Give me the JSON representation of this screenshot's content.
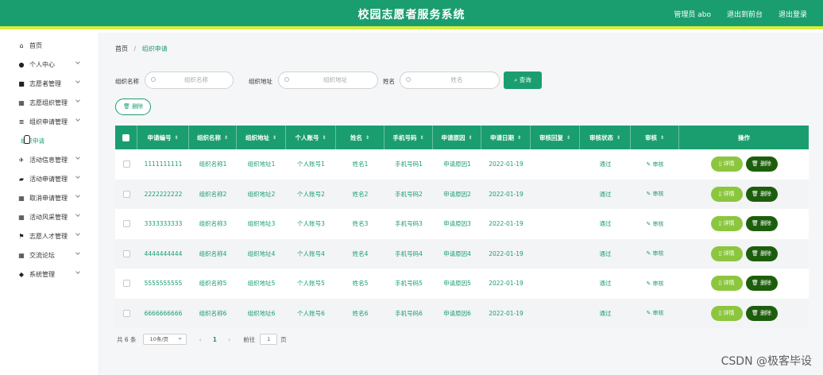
{
  "header": {
    "title": "校园志愿者服务系统",
    "user": "管理员 abo",
    "back_link": "退出到前台",
    "logout": "退出登录"
  },
  "sidebar": {
    "items": [
      {
        "label": "首页",
        "icon": "home-icon",
        "expandable": false
      },
      {
        "label": "个人中心",
        "icon": "user-icon",
        "expandable": true
      },
      {
        "label": "志愿者管理",
        "icon": "lock-icon",
        "expandable": true
      },
      {
        "label": "志愿组织管理",
        "icon": "grid-icon",
        "expandable": true
      },
      {
        "label": "组织申请管理",
        "icon": "list-icon",
        "expandable": true
      },
      {
        "label": "活动信息管理",
        "icon": "plane-icon",
        "expandable": true
      },
      {
        "label": "活动申请管理",
        "icon": "cart-icon",
        "expandable": true
      },
      {
        "label": "取消申请管理",
        "icon": "grid-icon",
        "expandable": true
      },
      {
        "label": "活动风采管理",
        "icon": "grid-icon",
        "expandable": true
      },
      {
        "label": "志愿人才管理",
        "icon": "flag-icon",
        "expandable": true
      },
      {
        "label": "交流论坛",
        "icon": "grid-icon",
        "expandable": true
      },
      {
        "label": "系统管理",
        "icon": "pin-icon",
        "expandable": true
      }
    ],
    "active_subitem": "组织申请"
  },
  "breadcrumb": {
    "home": "首页",
    "separator": "/",
    "current": "组织申请"
  },
  "search": {
    "org_name_label": "组织名称",
    "org_name_placeholder": "组织名称",
    "org_addr_label": "组织地址",
    "org_addr_placeholder": "组织地址",
    "name_label": "姓名",
    "name_placeholder": "姓名",
    "query_button": "查询"
  },
  "batch_delete_label": "删除",
  "table": {
    "columns": [
      "申请编号",
      "组织名称",
      "组织地址",
      "个人账号",
      "姓名",
      "手机号码",
      "申请原因",
      "申请日期",
      "审核回复",
      "审核状态",
      "审核",
      "操作"
    ],
    "rows": [
      [
        "1111111111",
        "组织名称1",
        "组织地址1",
        "个人账号1",
        "姓名1",
        "手机号码1",
        "申请原因1",
        "2022-01-19",
        "",
        "通过"
      ],
      [
        "2222222222",
        "组织名称2",
        "组织地址2",
        "个人账号2",
        "姓名2",
        "手机号码2",
        "申请原因2",
        "2022-01-19",
        "",
        "通过"
      ],
      [
        "3333333333",
        "组织名称3",
        "组织地址3",
        "个人账号3",
        "姓名3",
        "手机号码3",
        "申请原因3",
        "2022-01-19",
        "",
        "通过"
      ],
      [
        "4444444444",
        "组织名称4",
        "组织地址4",
        "个人账号4",
        "姓名4",
        "手机号码4",
        "申请原因4",
        "2022-01-19",
        "",
        "通过"
      ],
      [
        "5555555555",
        "组织名称5",
        "组织地址5",
        "个人账号5",
        "姓名5",
        "手机号码5",
        "申请原因5",
        "2022-01-19",
        "",
        "通过"
      ],
      [
        "6666666666",
        "组织名称6",
        "组织地址6",
        "个人账号6",
        "姓名6",
        "手机号码6",
        "申请原因6",
        "2022-01-19",
        "",
        "通过"
      ]
    ],
    "audit_label": "审核",
    "detail_label": "详情",
    "delete_label": "删除"
  },
  "pagination": {
    "total": "共 6 条",
    "page_size": "10条/页",
    "current_page": "1",
    "goto_label": "前往",
    "goto_value": "1",
    "page_unit": "页"
  },
  "watermark": "CSDN @极客毕设",
  "colors": {
    "primary": "#1a9e6f",
    "accent_bar": "#d8ee3c",
    "detail": "#8cc63f",
    "delete": "#1d5e0d"
  }
}
